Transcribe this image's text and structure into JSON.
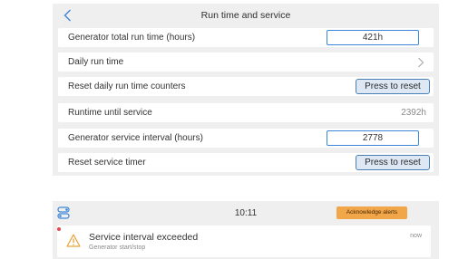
{
  "header": {
    "title": "Run time and service",
    "back_icon": "chevron-left-icon"
  },
  "rows": [
    {
      "label": "Generator total run time (hours)",
      "field_value": "421h"
    },
    {
      "label": "Daily run time",
      "icon": "chevron-right-icon"
    },
    {
      "label": "Reset daily run time counters",
      "button_label": "Press to reset"
    },
    {
      "label": "Runtime until service",
      "value": "2392h"
    },
    {
      "label": "Generator service interval (hours)",
      "field_value": "2778"
    },
    {
      "label": "Reset service timer",
      "button_label": "Press to reset"
    }
  ],
  "status_bar": {
    "menu_icon": "toggles-icon",
    "time": "10:11",
    "acknowledge_label": "Acknowledge alerts",
    "acknowledge_color": "#f2a64a"
  },
  "alert": {
    "title": "Service interval exceeded",
    "subtitle": "Generator start/stop",
    "time": "now",
    "icon": "warning-icon",
    "unread_color": "#e5484d"
  },
  "colors": {
    "accent": "#3d86d6",
    "panel_background": "#efefef"
  }
}
